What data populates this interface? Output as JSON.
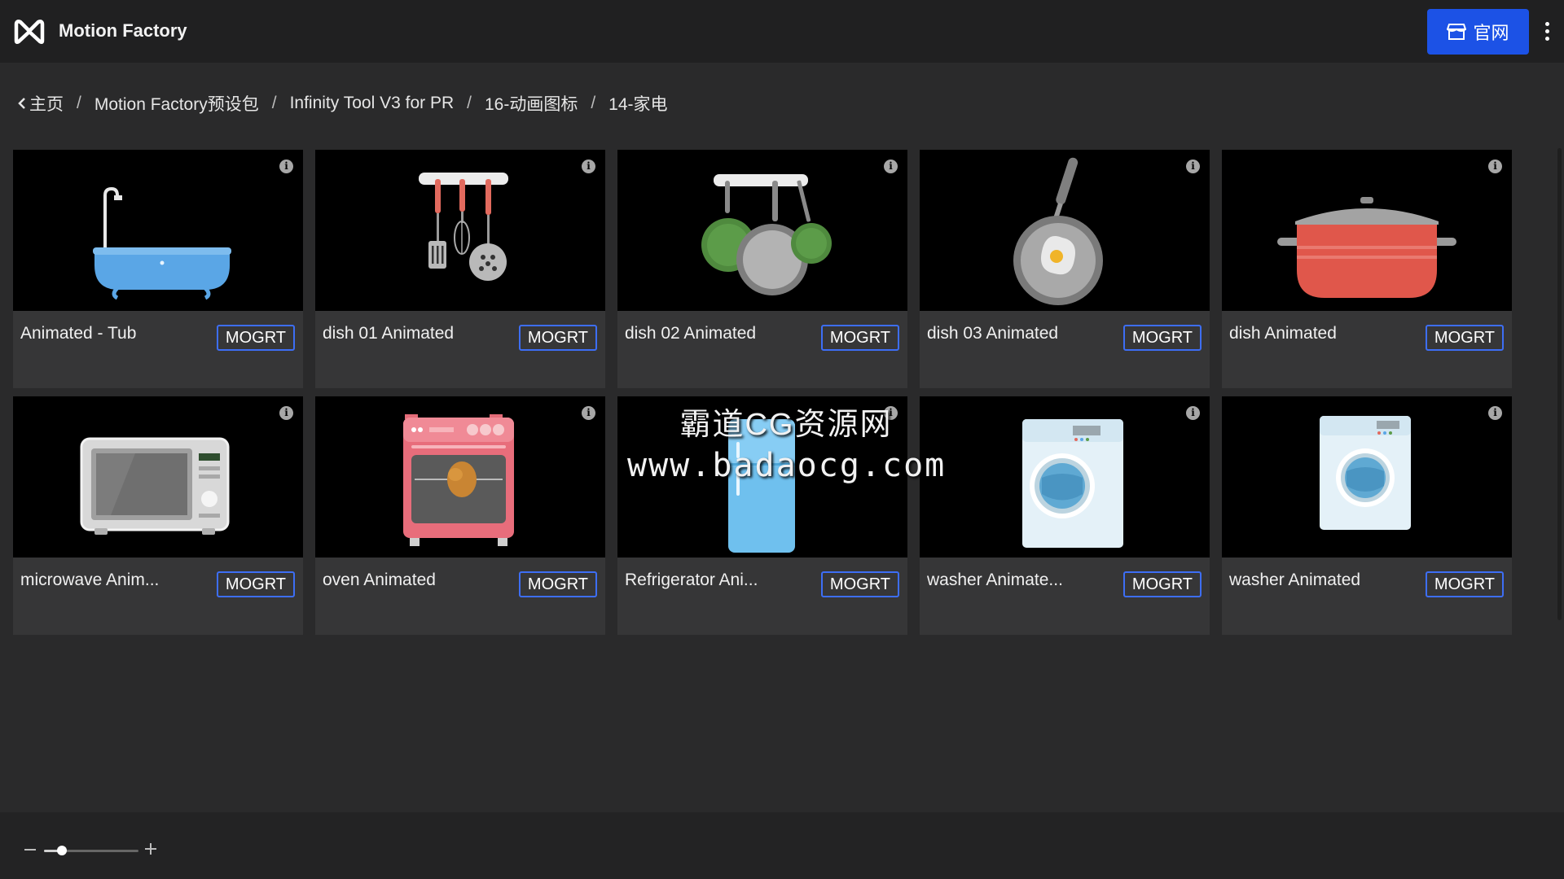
{
  "app": {
    "title": "Motion Factory",
    "site_button_label": "官网",
    "accent_color": "#1c52e6"
  },
  "breadcrumb": [
    {
      "label": "主页"
    },
    {
      "label": "Motion Factory预设包"
    },
    {
      "label": "Infinity Tool V3 for PR"
    },
    {
      "label": "16-动画图标"
    },
    {
      "label": "14-家电"
    }
  ],
  "items": [
    {
      "title": "Animated - Tub",
      "badge": "MOGRT",
      "icon": "bathtub"
    },
    {
      "title": "dish 01 Animated",
      "badge": "MOGRT",
      "icon": "kitchen-utensils"
    },
    {
      "title": "dish 02 Animated",
      "badge": "MOGRT",
      "icon": "hanging-pans"
    },
    {
      "title": "dish 03 Animated",
      "badge": "MOGRT",
      "icon": "frying-pan"
    },
    {
      "title": "dish Animated",
      "badge": "MOGRT",
      "icon": "cooking-pot"
    },
    {
      "title": "microwave Anim...",
      "badge": "MOGRT",
      "icon": "microwave"
    },
    {
      "title": "oven Animated",
      "badge": "MOGRT",
      "icon": "oven"
    },
    {
      "title": "Refrigerator Ani...",
      "badge": "MOGRT",
      "icon": "refrigerator"
    },
    {
      "title": "washer Animate...",
      "badge": "MOGRT",
      "icon": "washing-machine"
    },
    {
      "title": "washer Animated",
      "badge": "MOGRT",
      "icon": "washing-machine"
    }
  ],
  "watermark": {
    "line1": "霸道CG资源网",
    "line2": "www.badaocg.com"
  },
  "zoom": {
    "level": 0.19
  }
}
